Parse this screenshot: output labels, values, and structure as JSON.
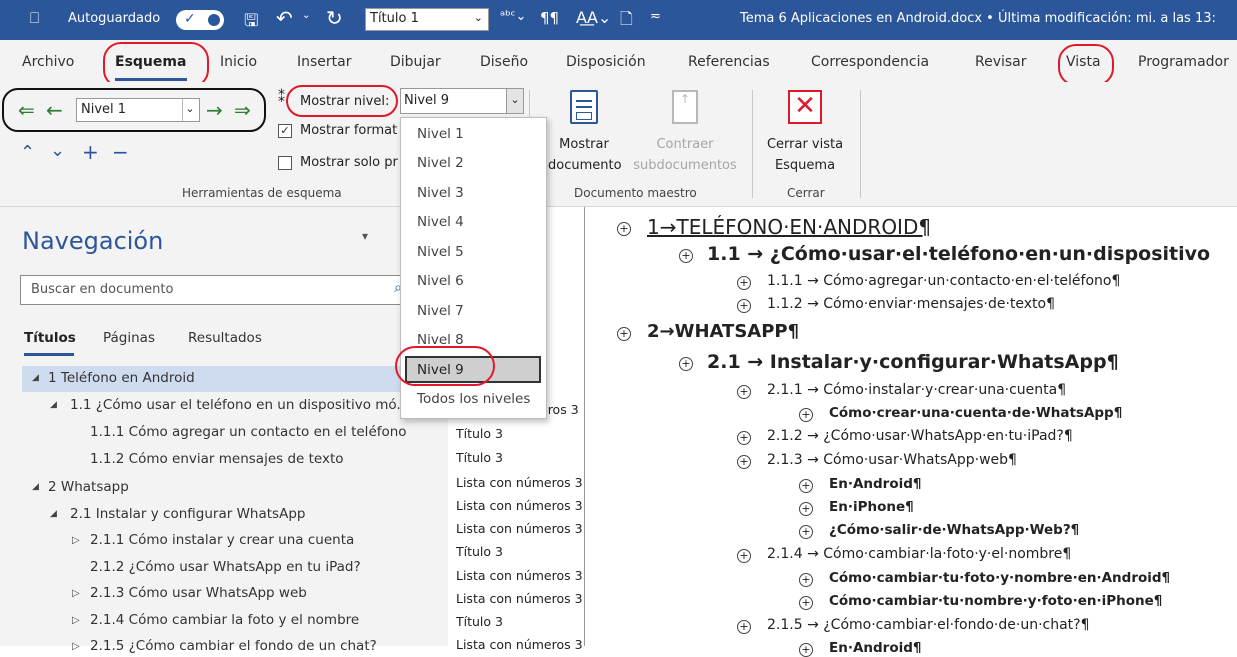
{
  "titlebar": {
    "autosave_label": "Autoguardado",
    "style_combo": "Título 1",
    "doc_info": "Tema 6 Aplicaciones en Android.docx • Última modificación: mi. a las 13:",
    "colors": {
      "bar": "#2b579a"
    }
  },
  "tabs": [
    "Archivo",
    "Esquema",
    "Inicio",
    "Insertar",
    "Dibujar",
    "Diseño",
    "Disposición",
    "Referencias",
    "Correspondencia",
    "Revisar",
    "Vista",
    "Programador"
  ],
  "ribbon": {
    "level_combo": "Nivel 1",
    "show_level_label": "Mostrar nivel:",
    "show_level_value": "Nivel 9",
    "show_format_label": "Mostrar format",
    "show_first_line_label": "Mostrar solo pr",
    "group1_label": "Herramientas de esquema",
    "show_document": [
      "Mostrar",
      "documento"
    ],
    "collapse_sub": [
      "Contraer",
      "subdocumentos"
    ],
    "group2_label": "Documento maestro",
    "close_view": [
      "Cerrar vista",
      "Esquema"
    ],
    "group3_label": "Cerrar"
  },
  "dropdown": {
    "items": [
      "Nivel 1",
      "Nivel 2",
      "Nivel 3",
      "Nivel 4",
      "Nivel 5",
      "Nivel 6",
      "Nivel 7",
      "Nivel 8",
      "Nivel 9",
      "Todos los niveles"
    ],
    "selected": "Nivel 9"
  },
  "nav": {
    "title": "Navegación",
    "search_placeholder": "Buscar en documento",
    "tabs": [
      "Títulos",
      "Páginas",
      "Resultados"
    ],
    "items": [
      "1 Teléfono en Android",
      "1.1 ¿Cómo usar el teléfono en un dispositivo mó...",
      "1.1.1 Cómo agregar un contacto en el teléfono",
      "1.1.2 Cómo enviar mensajes de texto",
      "2 Whatsapp",
      "2.1 Instalar y configurar WhatsApp",
      "2.1.1 Cómo instalar y crear una cuenta",
      "2.1.2 ¿Cómo usar WhatsApp en tu iPad?",
      "2.1.3 Cómo usar WhatsApp web",
      "2.1.4 Cómo cambiar la foto y el nombre",
      "2.1.5 ¿Cómo cambiar el fondo de un chat?"
    ]
  },
  "styles": [
    "eros 3",
    "Título 3",
    "Título 3",
    "Lista con números 3",
    "Lista con números 3",
    "Lista con números 3",
    "Título 3",
    "Lista con números 3",
    "Lista con números 3",
    "Título 3",
    "Lista con números 3"
  ],
  "doc": {
    "h1a": "1→TELÉFONO·EN·ANDROID¶",
    "h2a": "1.1 → ¿Cómo·usar·el·teléfono·en·un·dispositivo",
    "h3a": "1.1.1 → Cómo·agregar·un·contacto·en·el·teléfono¶",
    "h3b": "1.1.2 → Cómo·enviar·mensajes·de·texto¶",
    "h1b": "2→WHATSAPP¶",
    "h2b": "2.1 → Instalar·y·configurar·WhatsApp¶",
    "h3c": "2.1.1 → Cómo·instalar·y·crear·una·cuenta¶",
    "b1": "Cómo·crear·una·cuenta·de·WhatsApp¶",
    "h3d": "2.1.2 → ¿Cómo·usar·WhatsApp·en·tu·iPad?¶",
    "h3e": "2.1.3 → Cómo·usar·WhatsApp·web¶",
    "b2": "En·Android¶",
    "b3": "En·iPhone¶",
    "b4": "¿Cómo·salir·de·WhatsApp·Web?¶",
    "h3f": "2.1.4 → Cómo·cambiar·la·foto·y·el·nombre¶",
    "b5": "Cómo·cambiar·tu·foto·y·nombre·en·Android¶",
    "b6": "Cómo·cambiar·tu·nombre·y·foto·en·iPhone¶",
    "h3g": "2.1.5 → ¿Cómo·cambiar·el·fondo·de·un·chat?¶",
    "b7": "En·Android¶"
  }
}
